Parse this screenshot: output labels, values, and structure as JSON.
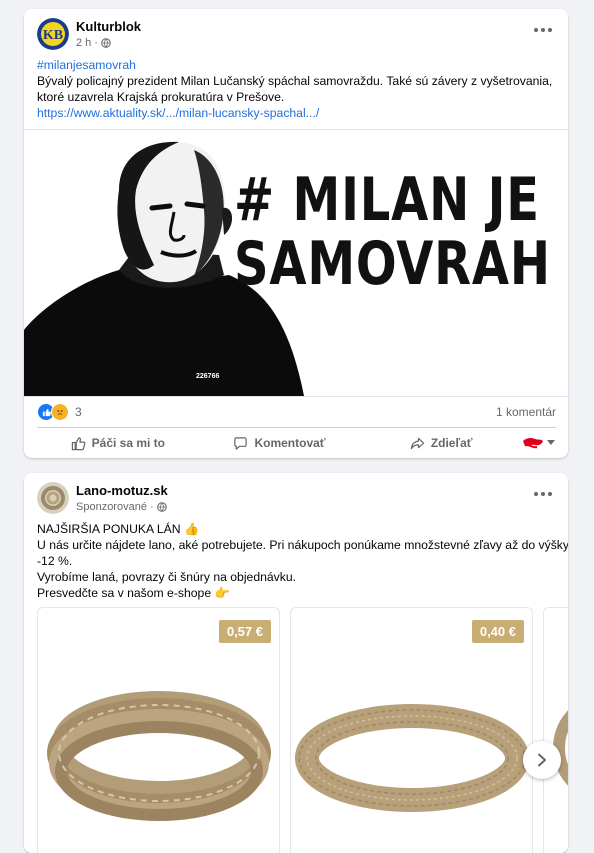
{
  "post1": {
    "author": "Kulturblok",
    "avatar_text": "KB",
    "time": "2 h",
    "hashtag": "#milanjesamovrah",
    "body_lines": [
      "Bývalý policajný prezident Milan Lučanský spáchal samovraždu. Také sú závery z vyšetrovania,",
      "ktoré uzavrela Krajská prokuratúra v Prešove."
    ],
    "link": "https://www.aktuality.sk/.../milan-lucansky-spachal.../",
    "image_title_line1": "# MILAN JE",
    "image_title_line2": "SAMOVRAH",
    "shirt_number": "226766",
    "reaction_count": "3",
    "comment_count": "1 komentár",
    "actions": {
      "like": "Páči sa mi to",
      "comment": "Komentovať",
      "share": "Zdieľať"
    }
  },
  "post2": {
    "author": "Lano-motuz.sk",
    "sponsored": "Sponzorované",
    "body_lines": [
      "NAJŠIRŠIA PONUKA LÁN 👍",
      "U nás určite nájdete lano, aké potrebujete. Pri nákupoch ponúkame množstevné zľavy až do výšky",
      "-12 %.",
      "Vyrobíme laná, povrazy či šnúry na objednávku.",
      "Presvedčte sa v našom e-shope 👉"
    ],
    "products": [
      {
        "price": "0,57 €"
      },
      {
        "price": "0,40 €"
      }
    ]
  },
  "icons": [
    "more-icon",
    "globe-icon",
    "like-icon",
    "comment-icon",
    "share-icon",
    "chevron-right-icon"
  ],
  "colors": {
    "link": "#216fdb",
    "price_badge": "#c9ae73",
    "like_blue": "#1877f2"
  }
}
